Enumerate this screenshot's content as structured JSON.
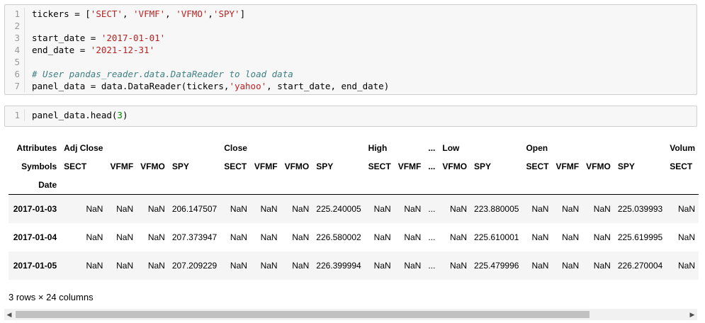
{
  "cell1": {
    "lines": [
      {
        "n": "1",
        "parts": [
          {
            "t": "tickers = [",
            "c": ""
          },
          {
            "t": "'SECT'",
            "c": "str"
          },
          {
            "t": ", ",
            "c": ""
          },
          {
            "t": "'VFMF'",
            "c": "str"
          },
          {
            "t": ", ",
            "c": ""
          },
          {
            "t": "'VFMO'",
            "c": "str"
          },
          {
            "t": ",",
            "c": ""
          },
          {
            "t": "'SPY'",
            "c": "str"
          },
          {
            "t": "]",
            "c": ""
          }
        ]
      },
      {
        "n": "2",
        "parts": []
      },
      {
        "n": "3",
        "parts": [
          {
            "t": "start_date = ",
            "c": ""
          },
          {
            "t": "'2017-01-01'",
            "c": "str"
          }
        ]
      },
      {
        "n": "4",
        "parts": [
          {
            "t": "end_date = ",
            "c": ""
          },
          {
            "t": "'2021-12-31'",
            "c": "str"
          }
        ]
      },
      {
        "n": "5",
        "parts": []
      },
      {
        "n": "6",
        "parts": [
          {
            "t": "# User pandas_reader.data.DataReader to load data",
            "c": "cm"
          }
        ]
      },
      {
        "n": "7",
        "parts": [
          {
            "t": "panel_data = data.DataReader(tickers,",
            "c": ""
          },
          {
            "t": "'yahoo'",
            "c": "str"
          },
          {
            "t": ", start_date, end_date)",
            "c": ""
          }
        ]
      }
    ]
  },
  "cell2": {
    "lines": [
      {
        "n": "1",
        "parts": [
          {
            "t": "panel_data.head(",
            "c": ""
          },
          {
            "t": "3",
            "c": "num"
          },
          {
            "t": ")",
            "c": ""
          }
        ]
      }
    ]
  },
  "table": {
    "attr_label": "Attributes",
    "sym_label": "Symbols",
    "date_label": "Date",
    "attr_row": [
      "Adj Close",
      "",
      "",
      "",
      "Close",
      "",
      "",
      "",
      "High",
      "",
      "...",
      "Low",
      "",
      "Open",
      "",
      "",
      "",
      "Volum"
    ],
    "sym_row": [
      "SECT",
      "VFMF",
      "VFMO",
      "SPY",
      "SECT",
      "VFMF",
      "VFMO",
      "SPY",
      "SECT",
      "VFMF",
      "...",
      "VFMO",
      "SPY",
      "SECT",
      "VFMF",
      "VFMO",
      "SPY",
      "SECT"
    ],
    "rows": [
      {
        "date": "2017-01-03",
        "cells": [
          "NaN",
          "NaN",
          "NaN",
          "206.147507",
          "NaN",
          "NaN",
          "NaN",
          "225.240005",
          "NaN",
          "NaN",
          "...",
          "NaN",
          "223.880005",
          "NaN",
          "NaN",
          "NaN",
          "225.039993",
          "NaN"
        ]
      },
      {
        "date": "2017-01-04",
        "cells": [
          "NaN",
          "NaN",
          "NaN",
          "207.373947",
          "NaN",
          "NaN",
          "NaN",
          "226.580002",
          "NaN",
          "NaN",
          "...",
          "NaN",
          "225.610001",
          "NaN",
          "NaN",
          "NaN",
          "225.619995",
          "NaN"
        ]
      },
      {
        "date": "2017-01-05",
        "cells": [
          "NaN",
          "NaN",
          "NaN",
          "207.209229",
          "NaN",
          "NaN",
          "NaN",
          "226.399994",
          "NaN",
          "NaN",
          "...",
          "NaN",
          "225.479996",
          "NaN",
          "NaN",
          "NaN",
          "226.270004",
          "NaN"
        ]
      }
    ]
  },
  "footer": {
    "rows_note": "3 rows × 24 columns"
  },
  "scrollbar": {
    "left_arrow": "◀",
    "right_arrow": "▶"
  }
}
